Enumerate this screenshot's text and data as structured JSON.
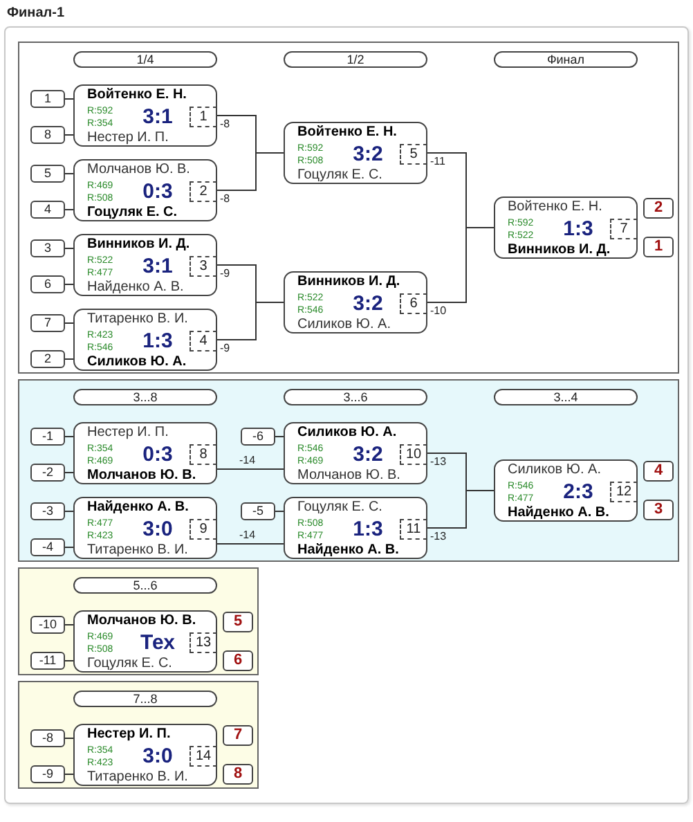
{
  "title": "Финал-1",
  "panels": [
    {
      "kind": "main",
      "rounds": [
        {
          "label": "1/4",
          "matches": [
            {
              "seeds": [
                "1",
                "8"
              ],
              "players": [
                {
                  "name": "Войтенко Е. Н.",
                  "rating": "R:592",
                  "won": true
                },
                {
                  "name": "Нестер И. П.",
                  "rating": "R:354",
                  "won": false
                }
              ],
              "score": "3:1",
              "number": "1",
              "next": "-8"
            },
            {
              "seeds": [
                "5",
                "4"
              ],
              "players": [
                {
                  "name": "Молчанов Ю. В.",
                  "rating": "R:469",
                  "won": false
                },
                {
                  "name": "Гоцуляк Е. С.",
                  "rating": "R:508",
                  "won": true
                }
              ],
              "score": "0:3",
              "number": "2",
              "next": "-8"
            },
            {
              "seeds": [
                "3",
                "6"
              ],
              "players": [
                {
                  "name": "Винников И. Д.",
                  "rating": "R:522",
                  "won": true
                },
                {
                  "name": "Найденко А. В.",
                  "rating": "R:477",
                  "won": false
                }
              ],
              "score": "3:1",
              "number": "3",
              "next": "-9"
            },
            {
              "seeds": [
                "7",
                "2"
              ],
              "players": [
                {
                  "name": "Титаренко В. И.",
                  "rating": "R:423",
                  "won": false
                },
                {
                  "name": "Силиков Ю. А.",
                  "rating": "R:546",
                  "won": true
                }
              ],
              "score": "1:3",
              "number": "4",
              "next": "-9"
            }
          ]
        },
        {
          "label": "1/2",
          "matches": [
            {
              "players": [
                {
                  "name": "Войтенко Е. Н.",
                  "rating": "R:592",
                  "won": true
                },
                {
                  "name": "Гоцуляк Е. С.",
                  "rating": "R:508",
                  "won": false
                }
              ],
              "score": "3:2",
              "number": "5",
              "next": "-11"
            },
            {
              "players": [
                {
                  "name": "Винников И. Д.",
                  "rating": "R:522",
                  "won": true
                },
                {
                  "name": "Силиков Ю. А.",
                  "rating": "R:546",
                  "won": false
                }
              ],
              "score": "3:2",
              "number": "6",
              "next": "-10"
            }
          ]
        },
        {
          "label": "Финал",
          "matches": [
            {
              "players": [
                {
                  "name": "Войтенко Е. Н.",
                  "rating": "R:592",
                  "won": false
                },
                {
                  "name": "Винников И. Д.",
                  "rating": "R:522",
                  "won": true
                }
              ],
              "score": "1:3",
              "number": "7",
              "places": [
                "2",
                "1"
              ]
            }
          ]
        }
      ]
    },
    {
      "kind": "repechage",
      "rounds": [
        {
          "label": "3...8",
          "matches": [
            {
              "seeds": [
                "-1",
                "-2"
              ],
              "players": [
                {
                  "name": "Нестер И. П.",
                  "rating": "R:354",
                  "won": false
                },
                {
                  "name": "Молчанов Ю. В.",
                  "rating": "R:469",
                  "won": true
                }
              ],
              "score": "0:3",
              "number": "8",
              "next": "-14"
            },
            {
              "seeds": [
                "-3",
                "-4"
              ],
              "players": [
                {
                  "name": "Найденко А. В.",
                  "rating": "R:477",
                  "won": true
                },
                {
                  "name": "Титаренко В. И.",
                  "rating": "R:423",
                  "won": false
                }
              ],
              "score": "3:0",
              "number": "9",
              "next": "-14"
            }
          ]
        },
        {
          "label": "3...6",
          "matches": [
            {
              "seeds": [
                "-6"
              ],
              "players": [
                {
                  "name": "Силиков Ю. А.",
                  "rating": "R:546",
                  "won": true
                },
                {
                  "name": "Молчанов Ю. В.",
                  "rating": "R:469",
                  "won": false
                }
              ],
              "score": "3:2",
              "number": "10",
              "next": "-13"
            },
            {
              "seeds": [
                "-5"
              ],
              "players": [
                {
                  "name": "Гоцуляк Е. С.",
                  "rating": "R:508",
                  "won": false
                },
                {
                  "name": "Найденко А. В.",
                  "rating": "R:477",
                  "won": true
                }
              ],
              "score": "1:3",
              "number": "11",
              "next": "-13"
            }
          ]
        },
        {
          "label": "3...4",
          "matches": [
            {
              "players": [
                {
                  "name": "Силиков Ю. А.",
                  "rating": "R:546",
                  "won": false
                },
                {
                  "name": "Найденко А. В.",
                  "rating": "R:477",
                  "won": true
                }
              ],
              "score": "2:3",
              "number": "12",
              "places": [
                "4",
                "3"
              ]
            }
          ]
        }
      ]
    },
    {
      "kind": "classification",
      "rounds": [
        {
          "label": "5...6",
          "matches": [
            {
              "seeds": [
                "-10",
                "-11"
              ],
              "players": [
                {
                  "name": "Молчанов Ю. В.",
                  "rating": "R:469",
                  "won": true
                },
                {
                  "name": "Гоцуляк Е. С.",
                  "rating": "R:508",
                  "won": false
                }
              ],
              "score": "Тех",
              "number": "13",
              "places": [
                "5",
                "6"
              ]
            }
          ]
        }
      ]
    },
    {
      "kind": "classification",
      "rounds": [
        {
          "label": "7...8",
          "matches": [
            {
              "seeds": [
                "-8",
                "-9"
              ],
              "players": [
                {
                  "name": "Нестер И. П.",
                  "rating": "R:354",
                  "won": true
                },
                {
                  "name": "Титаренко В. И.",
                  "rating": "R:423",
                  "won": false
                }
              ],
              "score": "3:0",
              "number": "14",
              "places": [
                "7",
                "8"
              ]
            }
          ]
        }
      ]
    }
  ]
}
